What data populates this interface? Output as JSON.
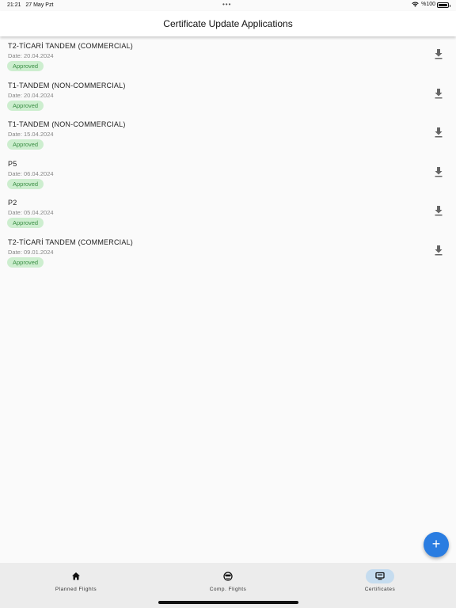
{
  "status": {
    "time": "21:21",
    "date": "27 May Pzt",
    "dots": "•••",
    "battery_text": "%100"
  },
  "header": {
    "title": "Certificate Update Applications"
  },
  "applications": [
    {
      "title": "T2-TİCARİ TANDEM (COMMERCIAL)",
      "date": "Date: 20.04.2024",
      "status": "Approved"
    },
    {
      "title": "T1-TANDEM (NON-COMMERCIAL)",
      "date": "Date: 20.04.2024",
      "status": "Approved"
    },
    {
      "title": "T1-TANDEM (NON-COMMERCIAL)",
      "date": "Date: 15.04.2024",
      "status": "Approved"
    },
    {
      "title": "P5",
      "date": "Date: 06.04.2024",
      "status": "Approved"
    },
    {
      "title": "P2",
      "date": "Date: 05.04.2024",
      "status": "Approved"
    },
    {
      "title": "T2-TİCARİ TANDEM (COMMERCIAL)",
      "date": "Date: 09.01.2024",
      "status": "Approved"
    }
  ],
  "fab": {
    "label": "+"
  },
  "nav": {
    "items": [
      {
        "label": "Planned Flights",
        "icon": "home-icon"
      },
      {
        "label": "Comp. Flights",
        "icon": "pilot-icon"
      },
      {
        "label": "Certificates",
        "icon": "certificate-icon",
        "active": true
      }
    ]
  },
  "colors": {
    "accent": "#2a7de1",
    "badge_bg": "#cdeecf",
    "badge_text": "#3b8f45",
    "nav_active": "#c5dcef"
  }
}
